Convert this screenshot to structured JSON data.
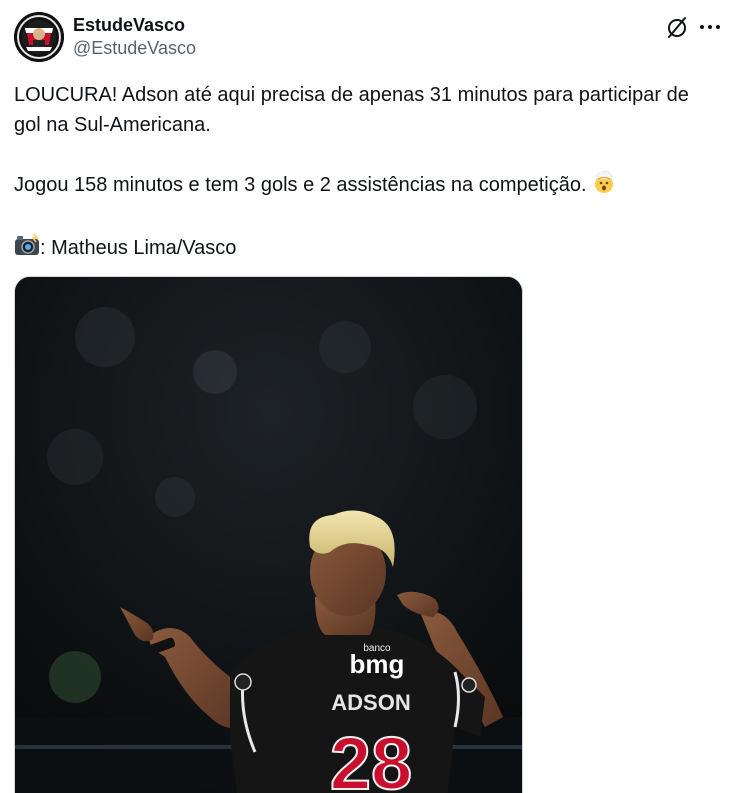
{
  "author": {
    "display_name": "EstudeVasco",
    "handle": "@EstudeVasco",
    "avatar_icon": "estudevasco-logo-avatar"
  },
  "actions": {
    "grok_icon": "grok-slash-icon",
    "more_icon": "more-dots-icon"
  },
  "tweet": {
    "line1": "LOUCURA! Adson até aqui precisa de apenas 31 minutos para participar de gol na Sul-Americana.",
    "line2_text": "Jogou 158 minutos e tem 3 gols e 2 assistências na competição.",
    "line2_emoji": "exploding-head-emoji",
    "credit_emoji": "camera-flash-emoji",
    "credit_text": ": Matheus Lima/Vasco"
  },
  "media": {
    "type": "photo",
    "description_icon": "player-photo",
    "sponsor_small": "banco",
    "sponsor": "bmg",
    "player_name": "ADSON",
    "player_number": "28"
  },
  "colors": {
    "text_primary": "#0f1419",
    "text_secondary": "#536471",
    "border": "#cfd9de",
    "jersey": "#141414",
    "number_red": "#c8102e"
  }
}
